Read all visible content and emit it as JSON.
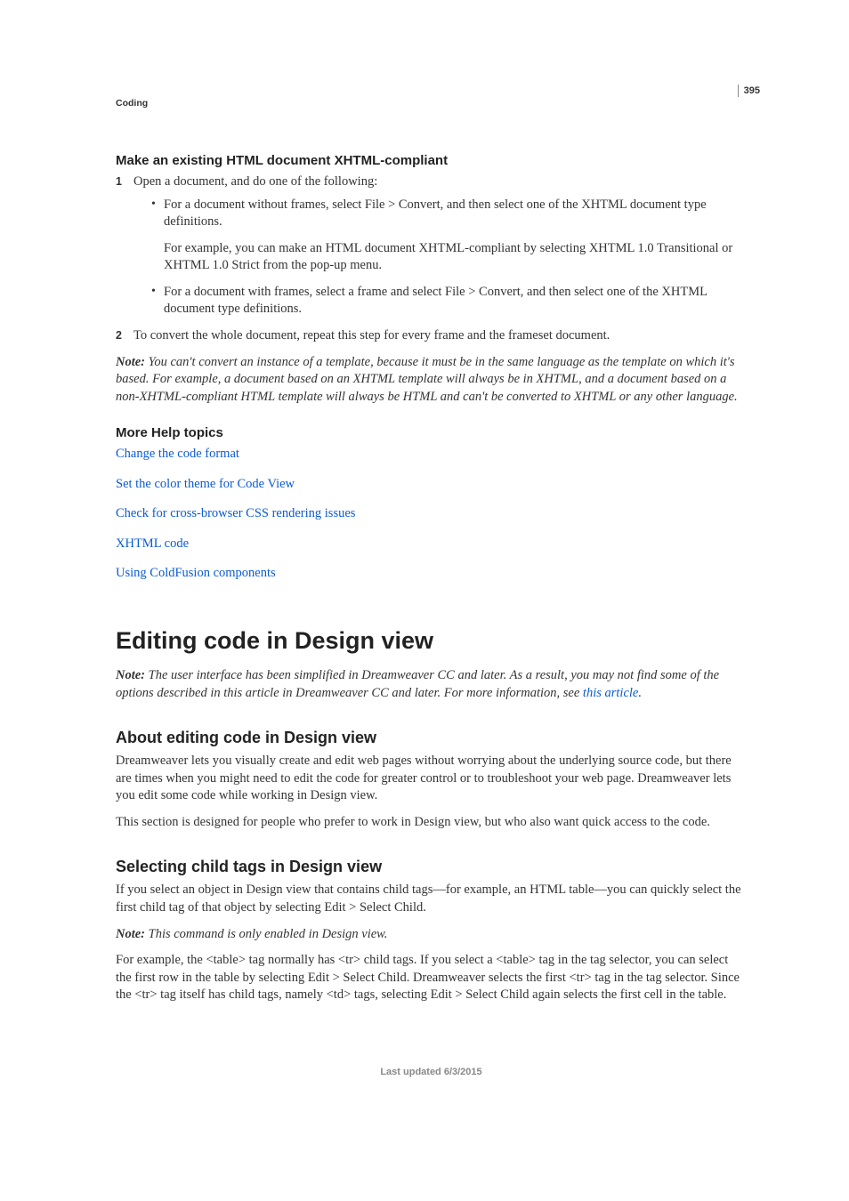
{
  "pagenum": "395",
  "runhead": "Coding",
  "section1": {
    "heading": "Make an existing HTML document XHTML-compliant",
    "step1_num": "1",
    "step1_text": "Open a document, and do one of the following:",
    "bullet1": "For a document without frames, select File > Convert, and then select one of the XHTML document type definitions.",
    "bullet1_sub": "For example, you can make an HTML document XHTML-compliant by selecting XHTML 1.0 Transitional or XHTML 1.0 Strict from the pop-up menu.",
    "bullet2": "For a document with frames, select a frame and select File > Convert, and then select one of the XHTML document type definitions.",
    "step2_num": "2",
    "step2_text": "To convert the whole document, repeat this step for every frame and the frameset document.",
    "note_label": "Note: ",
    "note_text": "You can't convert an instance of a template, because it must be in the same language as the template on which it's based. For example, a document based on an XHTML template will always be in XHTML, and a document based on a non-XHTML-compliant HTML template will always be HTML and can't be converted to XHTML or any other language."
  },
  "morehelp": {
    "heading": "More Help topics",
    "link1": "Change the code format",
    "link2": "Set the color theme for Code View",
    "link3": "Check for cross-browser CSS rendering issues",
    "link4": "XHTML code",
    "link5": "Using ColdFusion components"
  },
  "title": "Editing code in Design view",
  "intro_note_label": "Note: ",
  "intro_note_text1": "The user interface has been simplified in Dreamweaver CC and later. As a result, you may not find some of the options described in this article in Dreamweaver CC and later. For more information, see ",
  "intro_note_link": "this article",
  "intro_note_text2": ".",
  "section2": {
    "heading": "About editing code in Design view",
    "p1": "Dreamweaver lets you visually create and edit web pages without worrying about the underlying source code, but there are times when you might need to edit the code for greater control or to troubleshoot your web page. Dreamweaver lets you edit some code while working in Design view.",
    "p2": "This section is designed for people who prefer to work in Design view, but who also want quick access to the code."
  },
  "section3": {
    "heading": "Selecting child tags in Design view",
    "p1": "If you select an object in Design view that contains child tags—for example, an HTML table—you can quickly select the first child tag of that object by selecting Edit > Select Child.",
    "note_label": "Note: ",
    "note_text": "This command is only enabled in Design view.",
    "p2": "For example, the <table> tag normally has <tr> child tags. If you select a <table> tag in the tag selector, you can select the first row in the table by selecting Edit > Select Child. Dreamweaver selects the first <tr> tag in the tag selector. Since the <tr> tag itself has child tags, namely <td> tags, selecting Edit > Select Child again selects the first cell in the table."
  },
  "footer": "Last updated 6/3/2015"
}
